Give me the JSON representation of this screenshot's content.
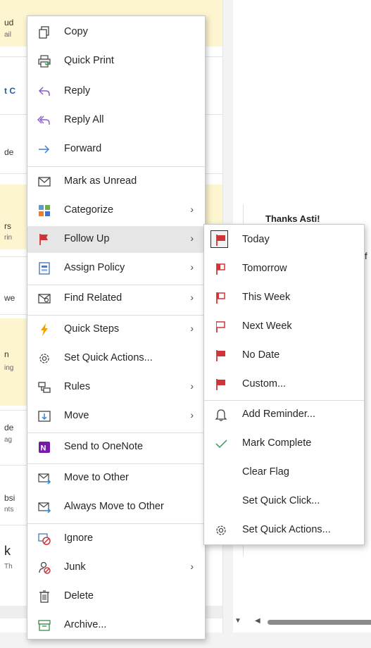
{
  "background": {
    "list_fragments": [
      "ud",
      "ail",
      "t C",
      "de",
      "rs",
      "rin",
      "we",
      "n",
      "ing",
      "de",
      "ag",
      "bsi",
      "nts",
      "k",
      "Th"
    ],
    "reading_text_1": "Thanks Asti!",
    "reading_text_2": "f"
  },
  "context_menu": {
    "items": [
      {
        "label": "Copy"
      },
      {
        "label": "Quick Print"
      },
      {
        "label": "Reply"
      },
      {
        "label": "Reply All"
      },
      {
        "label": "Forward"
      },
      {
        "label": "Mark as Unread"
      },
      {
        "label": "Categorize"
      },
      {
        "label": "Follow Up"
      },
      {
        "label": "Assign Policy"
      },
      {
        "label": "Find Related"
      },
      {
        "label": "Quick Steps"
      },
      {
        "label": "Set Quick Actions..."
      },
      {
        "label": "Rules"
      },
      {
        "label": "Move"
      },
      {
        "label": "Send to OneNote"
      },
      {
        "label": "Move to Other"
      },
      {
        "label": "Always Move to Other"
      },
      {
        "label": "Ignore"
      },
      {
        "label": "Junk"
      },
      {
        "label": "Delete"
      },
      {
        "label": "Archive..."
      }
    ],
    "chevron": "›"
  },
  "follow_up_submenu": {
    "items": [
      {
        "label": "Today"
      },
      {
        "label": "Tomorrow"
      },
      {
        "label": "This Week"
      },
      {
        "label": "Next Week"
      },
      {
        "label": "No Date"
      },
      {
        "label": "Custom..."
      },
      {
        "label": "Add Reminder..."
      },
      {
        "label": "Mark Complete"
      },
      {
        "label": "Clear Flag"
      },
      {
        "label": "Set Quick Click..."
      },
      {
        "label": "Set Quick Actions..."
      }
    ]
  },
  "colors": {
    "flag_red": "#d13438",
    "reply_purple": "#8a5dc9",
    "forward_blue": "#3b82d6",
    "check_green": "#4aa564",
    "onenote_purple": "#7719aa",
    "quicksteps_orange": "#f2a100",
    "categorize_colors": [
      "#5b9bd5",
      "#70ad47",
      "#ed7d31",
      "#4472c4"
    ]
  }
}
